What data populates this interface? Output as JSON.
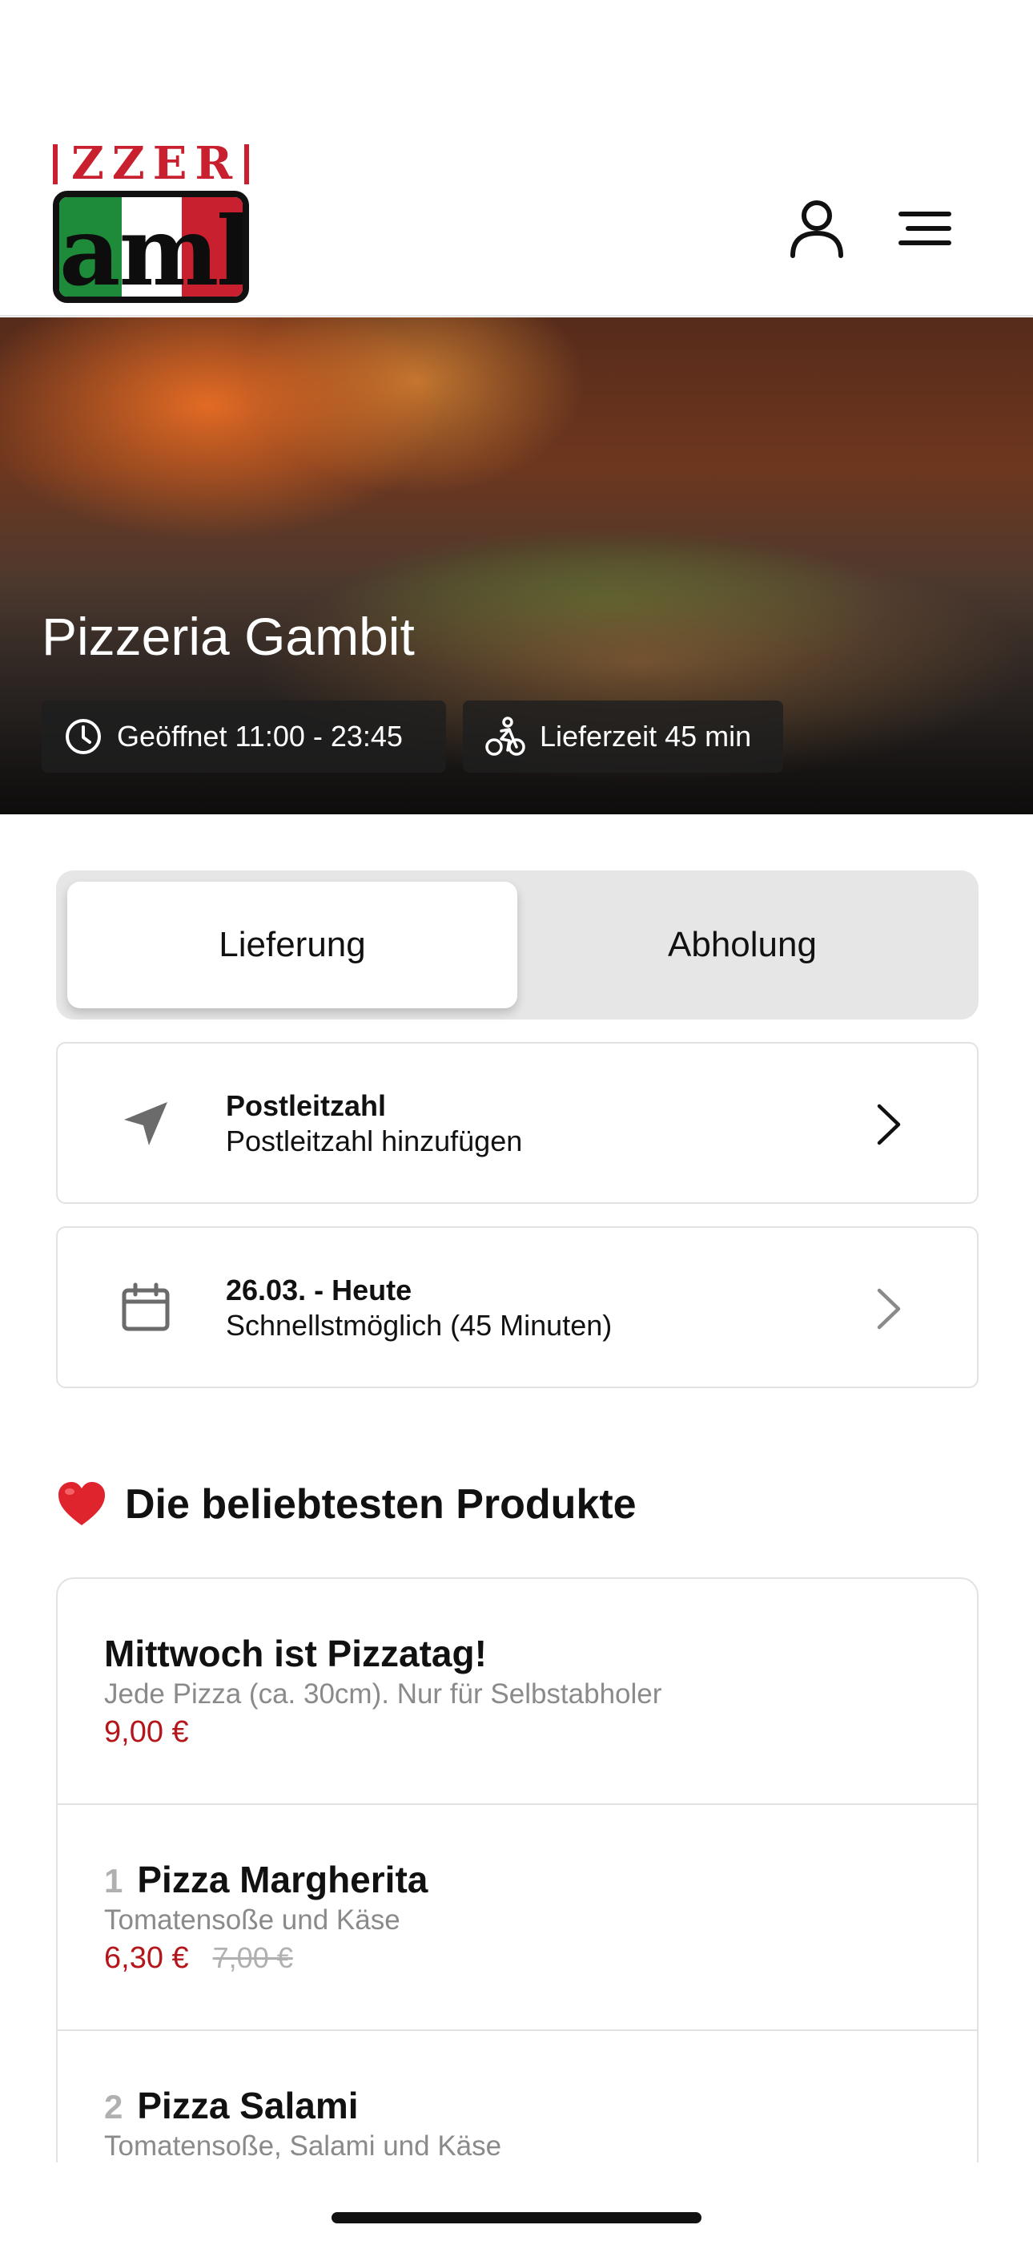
{
  "header": {
    "logo_text_top": "ZZER",
    "logo_text_main": "amb",
    "profile_icon": "user-icon",
    "menu_icon": "menu-icon"
  },
  "hero": {
    "title": "Pizzeria Gambit",
    "opening_hours": "Geöffnet 11:00 - 23:45",
    "delivery_time": "Lieferzeit 45 min",
    "hours_icon": "clock-icon",
    "delivery_icon": "bike-icon"
  },
  "order_mode": {
    "options": [
      "Lieferung",
      "Abholung"
    ],
    "selected": "Lieferung"
  },
  "postal_card": {
    "icon": "location-arrow-icon",
    "title": "Postleitzahl",
    "subtitle": "Postleitzahl hinzufügen"
  },
  "date_card": {
    "icon": "calendar-icon",
    "title": "26.03. - Heute",
    "subtitle": "Schnellstmöglich (45 Minuten)"
  },
  "popular": {
    "title": "Die beliebtesten Produkte",
    "icon": "heart-icon",
    "products": [
      {
        "number": "",
        "name": "Mittwoch ist Pizzatag!",
        "description": "Jede Pizza (ca. 30cm). Nur für Selbstabholer",
        "price": "9,00 €",
        "old_price": ""
      },
      {
        "number": "1",
        "name": "Pizza Margherita",
        "description": "Tomatensoße und Käse",
        "price": "6,30 €",
        "old_price": "7,00 €"
      },
      {
        "number": "2",
        "name": "Pizza Salami",
        "description": "Tomatensoße, Salami und Käse",
        "price": "",
        "old_price": ""
      }
    ]
  },
  "colors": {
    "accent_red": "#b4161b",
    "muted_gray": "#8a8a8a",
    "segment_bg": "#e6e6e6"
  }
}
